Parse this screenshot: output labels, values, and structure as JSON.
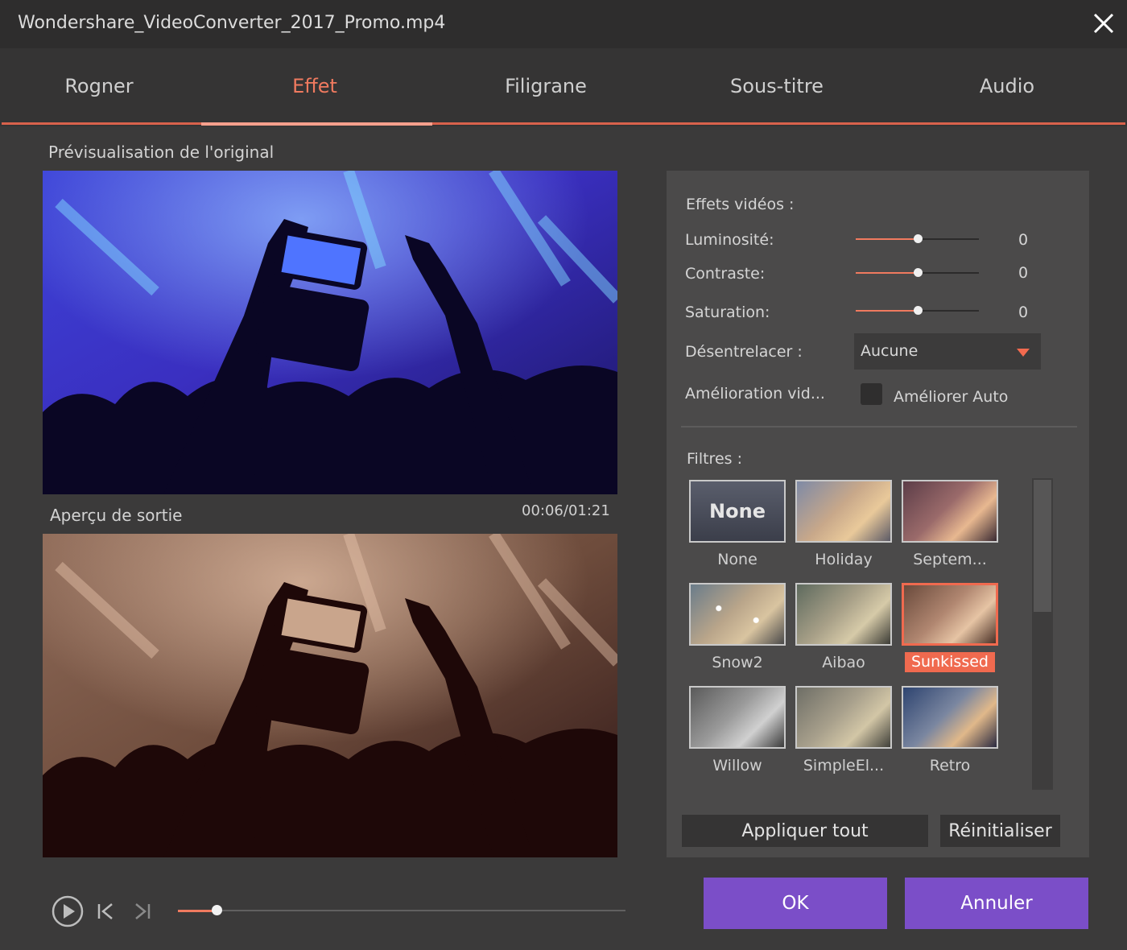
{
  "window": {
    "title": "Wondershare_VideoConverter_2017_Promo.mp4",
    "close_icon": "close-icon"
  },
  "tabs": [
    {
      "label": "Rogner"
    },
    {
      "label": "Effet",
      "active": true
    },
    {
      "label": "Filigrane"
    },
    {
      "label": "Sous-titre"
    },
    {
      "label": "Audio"
    }
  ],
  "preview": {
    "original_label": "Prévisualisation de l'original",
    "output_label": "Aperçu de sortie",
    "timecode": "00:06/01:21"
  },
  "player": {
    "play_icon": "play-icon",
    "prev_icon": "skip-back-icon",
    "next_icon": "skip-forward-icon",
    "progress": 0.087
  },
  "effects": {
    "heading": "Effets vidéos :",
    "sliders": [
      {
        "label": "Luminosité:",
        "value": "0",
        "fraction": 0.5
      },
      {
        "label": "Contraste:",
        "value": "0",
        "fraction": 0.5
      },
      {
        "label": "Saturation:",
        "value": "0",
        "fraction": 0.5
      }
    ],
    "deinterlace": {
      "label": "Désentrelacer :",
      "value": "Aucune"
    },
    "enhance": {
      "label": "Amélioration vid...",
      "checkbox_label": "Améliorer Auto",
      "checked": false
    }
  },
  "filters": {
    "heading": "Filtres :",
    "items": [
      {
        "name": "None",
        "thumb_text": "None"
      },
      {
        "name": "Holiday"
      },
      {
        "name": "Septem..."
      },
      {
        "name": "Snow2"
      },
      {
        "name": "Aibao"
      },
      {
        "name": "Sunkissed",
        "selected": true
      },
      {
        "name": "Willow"
      },
      {
        "name": "SimpleEl..."
      },
      {
        "name": "Retro"
      }
    ]
  },
  "buttons": {
    "apply_all": "Appliquer tout",
    "reset": "Réinitialiser",
    "ok": "OK",
    "cancel": "Annuler"
  },
  "colors": {
    "accent": "#f07a5f",
    "primary_button": "#7b4ec8",
    "selected_filter": "#f06a4f"
  }
}
